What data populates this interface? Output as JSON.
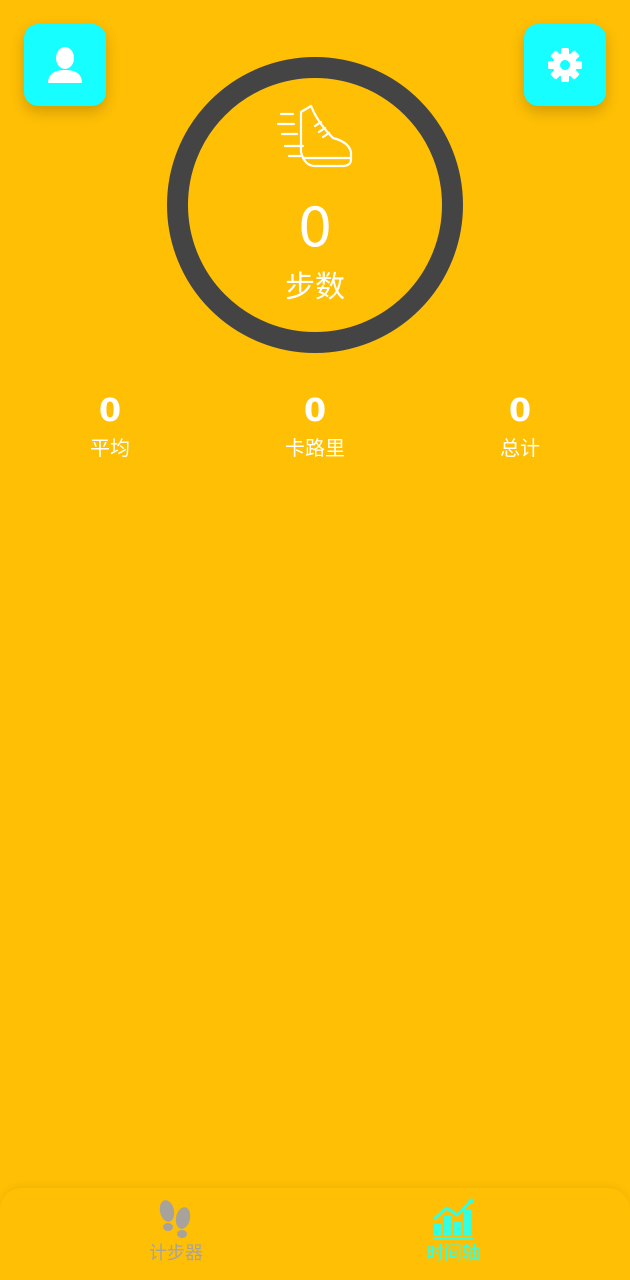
{
  "header": {
    "left_icon": "user-icon",
    "right_icon": "gear-icon"
  },
  "ring": {
    "icon": "running-shoe-icon",
    "value": "0",
    "label": "步数"
  },
  "stats": [
    {
      "value": "0",
      "label": "平均"
    },
    {
      "value": "0",
      "label": "卡路里"
    },
    {
      "value": "0",
      "label": "总计"
    }
  ],
  "bottom_nav": {
    "items": [
      {
        "label": "计步器",
        "icon": "footprints-icon",
        "active": false
      },
      {
        "label": "时间轴",
        "icon": "chart-icon",
        "active": true
      }
    ]
  },
  "colors": {
    "background": "#FFBF05",
    "accent": "#16FEFF",
    "ring": "#444444",
    "active_nav": "#33FFE2",
    "inactive_nav": "#A7A39C"
  }
}
